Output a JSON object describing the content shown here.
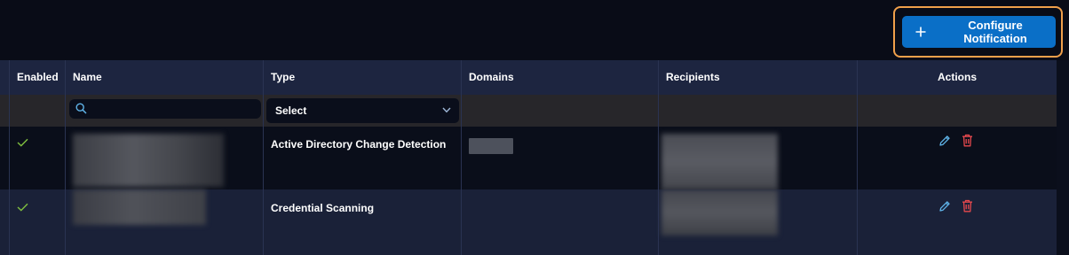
{
  "toolbar": {
    "configure_button_label": "Configure Notification"
  },
  "table": {
    "columns": [
      "Enabled",
      "Name",
      "Type",
      "Domains",
      "Recipients",
      "Actions"
    ],
    "filters": {
      "name_search_placeholder": "",
      "type_select_value": "Select"
    },
    "rows": [
      {
        "enabled": true,
        "type": "Active Directory Change Detection"
      },
      {
        "enabled": true,
        "type": "Credential Scanning"
      }
    ]
  },
  "icons": {
    "add": "plus-icon",
    "search": "search-icon",
    "dropdown": "chevron-down-icon",
    "enabled": "check-icon",
    "edit": "pencil-icon",
    "delete": "trash-icon"
  },
  "colors": {
    "background": "#090c17",
    "header_row": "#1d2540",
    "primary_button": "#0a6fc7",
    "focus_outline": "#f0a04b",
    "check": "#7fbf3f",
    "edit_icon": "#5fb3e8",
    "delete_icon": "#e5484d"
  }
}
